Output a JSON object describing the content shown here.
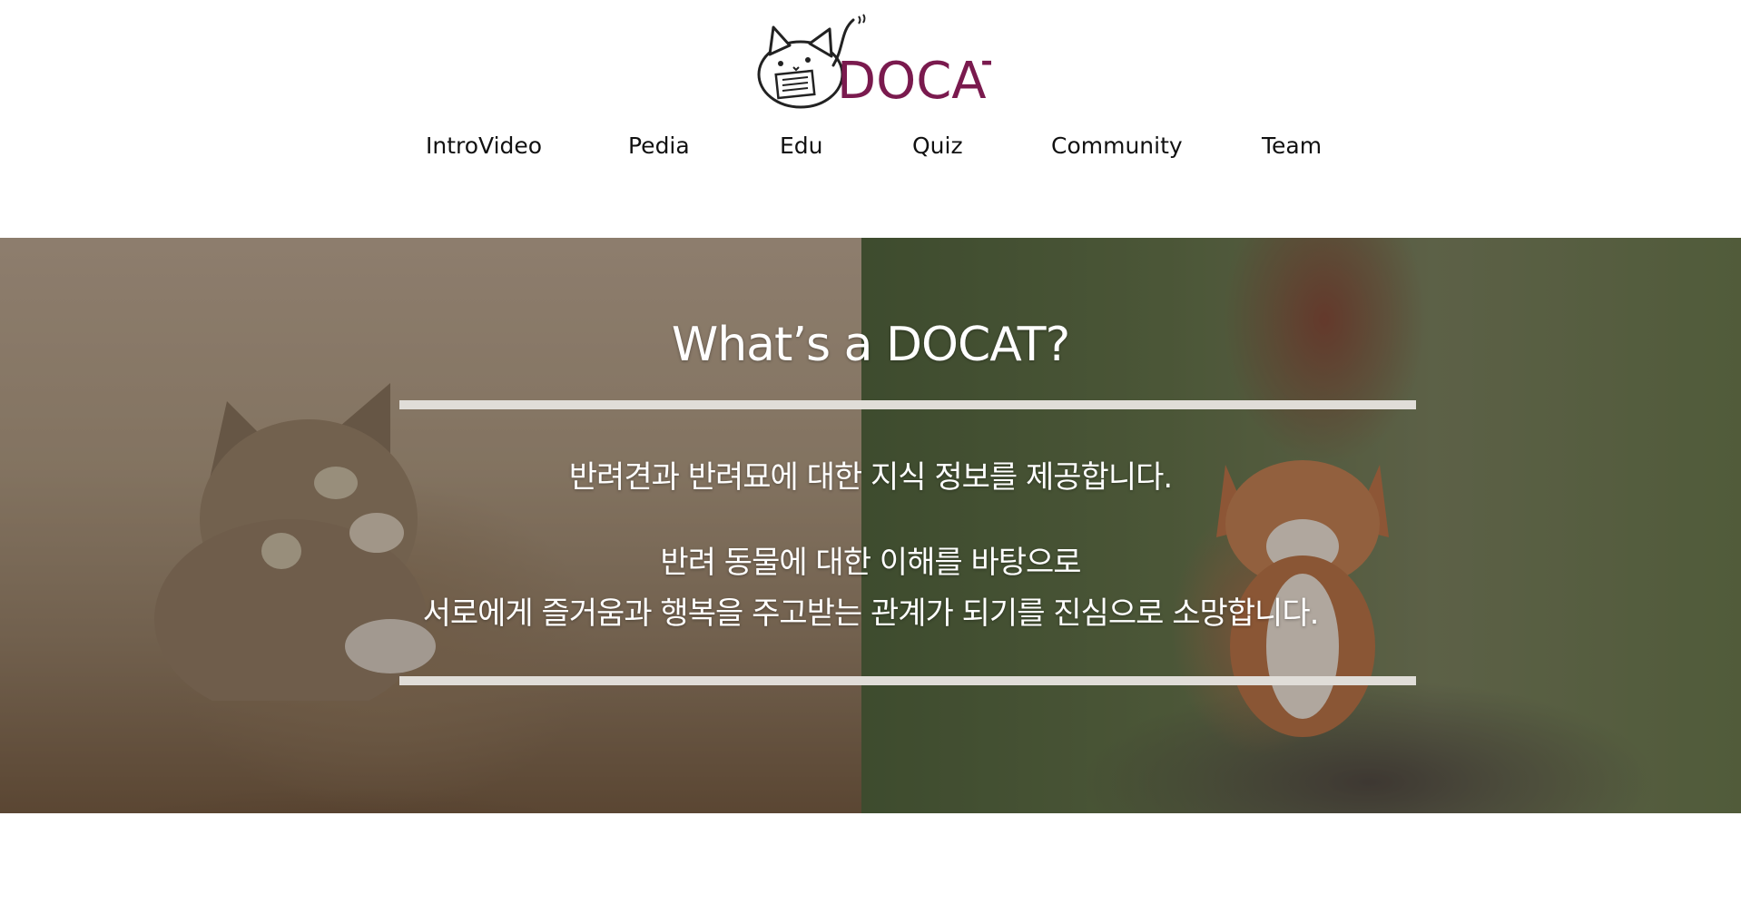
{
  "brand": {
    "logo_text": "DOCAT"
  },
  "nav": {
    "items": [
      {
        "label": "IntroVideo"
      },
      {
        "label": "Pedia"
      },
      {
        "label": "Edu"
      },
      {
        "label": "Quiz"
      },
      {
        "label": "Community"
      },
      {
        "label": "Team"
      }
    ]
  },
  "hero": {
    "title": "What’s a DOCAT?",
    "line1": "반려견과 반려묘에 대한 지식 정보를 제공합니다.",
    "line2": "반려 동물에 대한 이해를 바탕으로",
    "line3": "서로에게 즐거움과 행복을 주고받는 관계가 되기를 진심으로 소망합니다.",
    "left_image": "kitten-photo",
    "right_image": "corgi-photo"
  },
  "colors": {
    "brand": "#7a1a4e",
    "nav_text": "#111111",
    "divider": "#e0ddd8",
    "hero_text": "#ffffff"
  }
}
